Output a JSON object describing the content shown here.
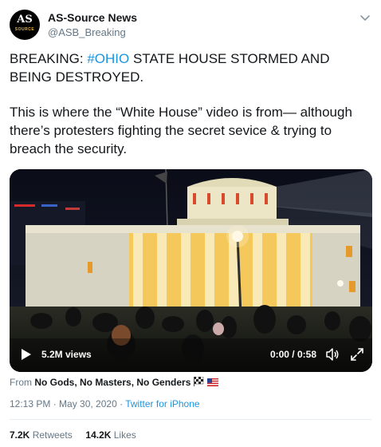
{
  "author": {
    "name": "AS-Source News",
    "handle": "@ASB_Breaking",
    "avatar_text_top": "AS",
    "avatar_text_bottom": "SOURCE"
  },
  "tweet": {
    "line1_prefix": "BREAKING: ",
    "hashtag": "#OHIO",
    "line1_suffix": " STATE HOUSE STORMED AND BEING DESTROYED.",
    "paragraph2": "This is where the “White House” video is from— although there’s protesters fighting the secret sevice & trying to breach the security."
  },
  "video": {
    "views": "5.2M views",
    "time": "0:00 / 0:58"
  },
  "source": {
    "prefix": "From ",
    "name": "No Gods, No Masters, No Genders"
  },
  "meta": {
    "timestamp": "12:13 PM · May 30, 2020 · ",
    "client": "Twitter for iPhone"
  },
  "stats": {
    "retweets_count": "7.2K",
    "retweets_label": " Retweets",
    "likes_count": "14.2K",
    "likes_label": " Likes"
  },
  "icons": {
    "menu": "chevron-down-icon",
    "play": "play-icon",
    "volume": "volume-icon",
    "fullscreen": "fullscreen-icon"
  }
}
